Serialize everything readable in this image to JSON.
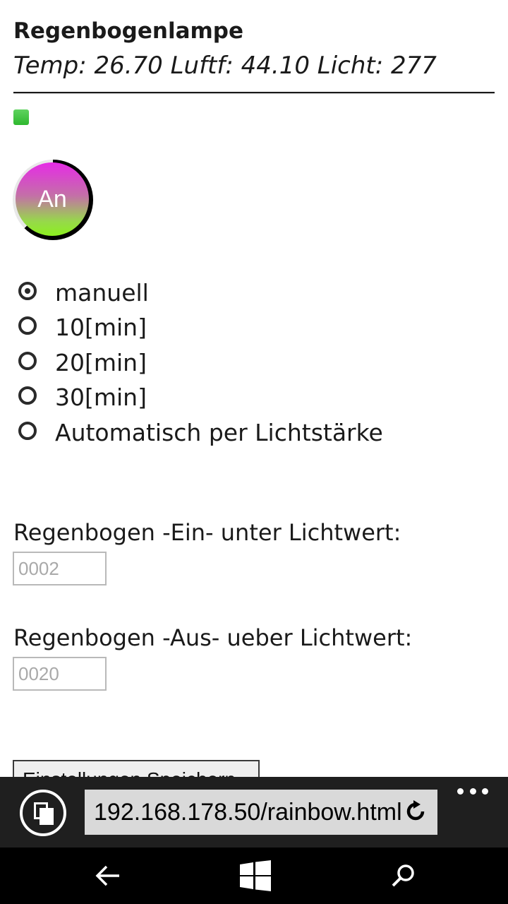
{
  "header": {
    "title": "Regenbogenlampe",
    "sensor_line": "Temp: 26.70 Luftf: 44.10 Licht: 277"
  },
  "status": {
    "led_color": "#3cc43c"
  },
  "power_button": {
    "label": "An",
    "gradient_top": "#e62be6",
    "gradient_bottom": "#8cf01e"
  },
  "modes": {
    "selected": "manuell",
    "options": [
      {
        "label": "manuell",
        "checked": true
      },
      {
        "label": "10[min]",
        "checked": false
      },
      {
        "label": "20[min]",
        "checked": false
      },
      {
        "label": "30[min]",
        "checked": false
      },
      {
        "label": "Automatisch per Lichtstärke",
        "checked": false
      }
    ]
  },
  "thresholds": {
    "on_label": "Regenbogen -Ein- unter Lichtwert:",
    "on_placeholder": "0002",
    "off_label": "Regenbogen -Aus- ueber Lichtwert:",
    "off_placeholder": "0020"
  },
  "actions": {
    "save_label": "Einstellungen Speichern"
  },
  "browser": {
    "url": "192.168.178.50/rainbow.html"
  }
}
